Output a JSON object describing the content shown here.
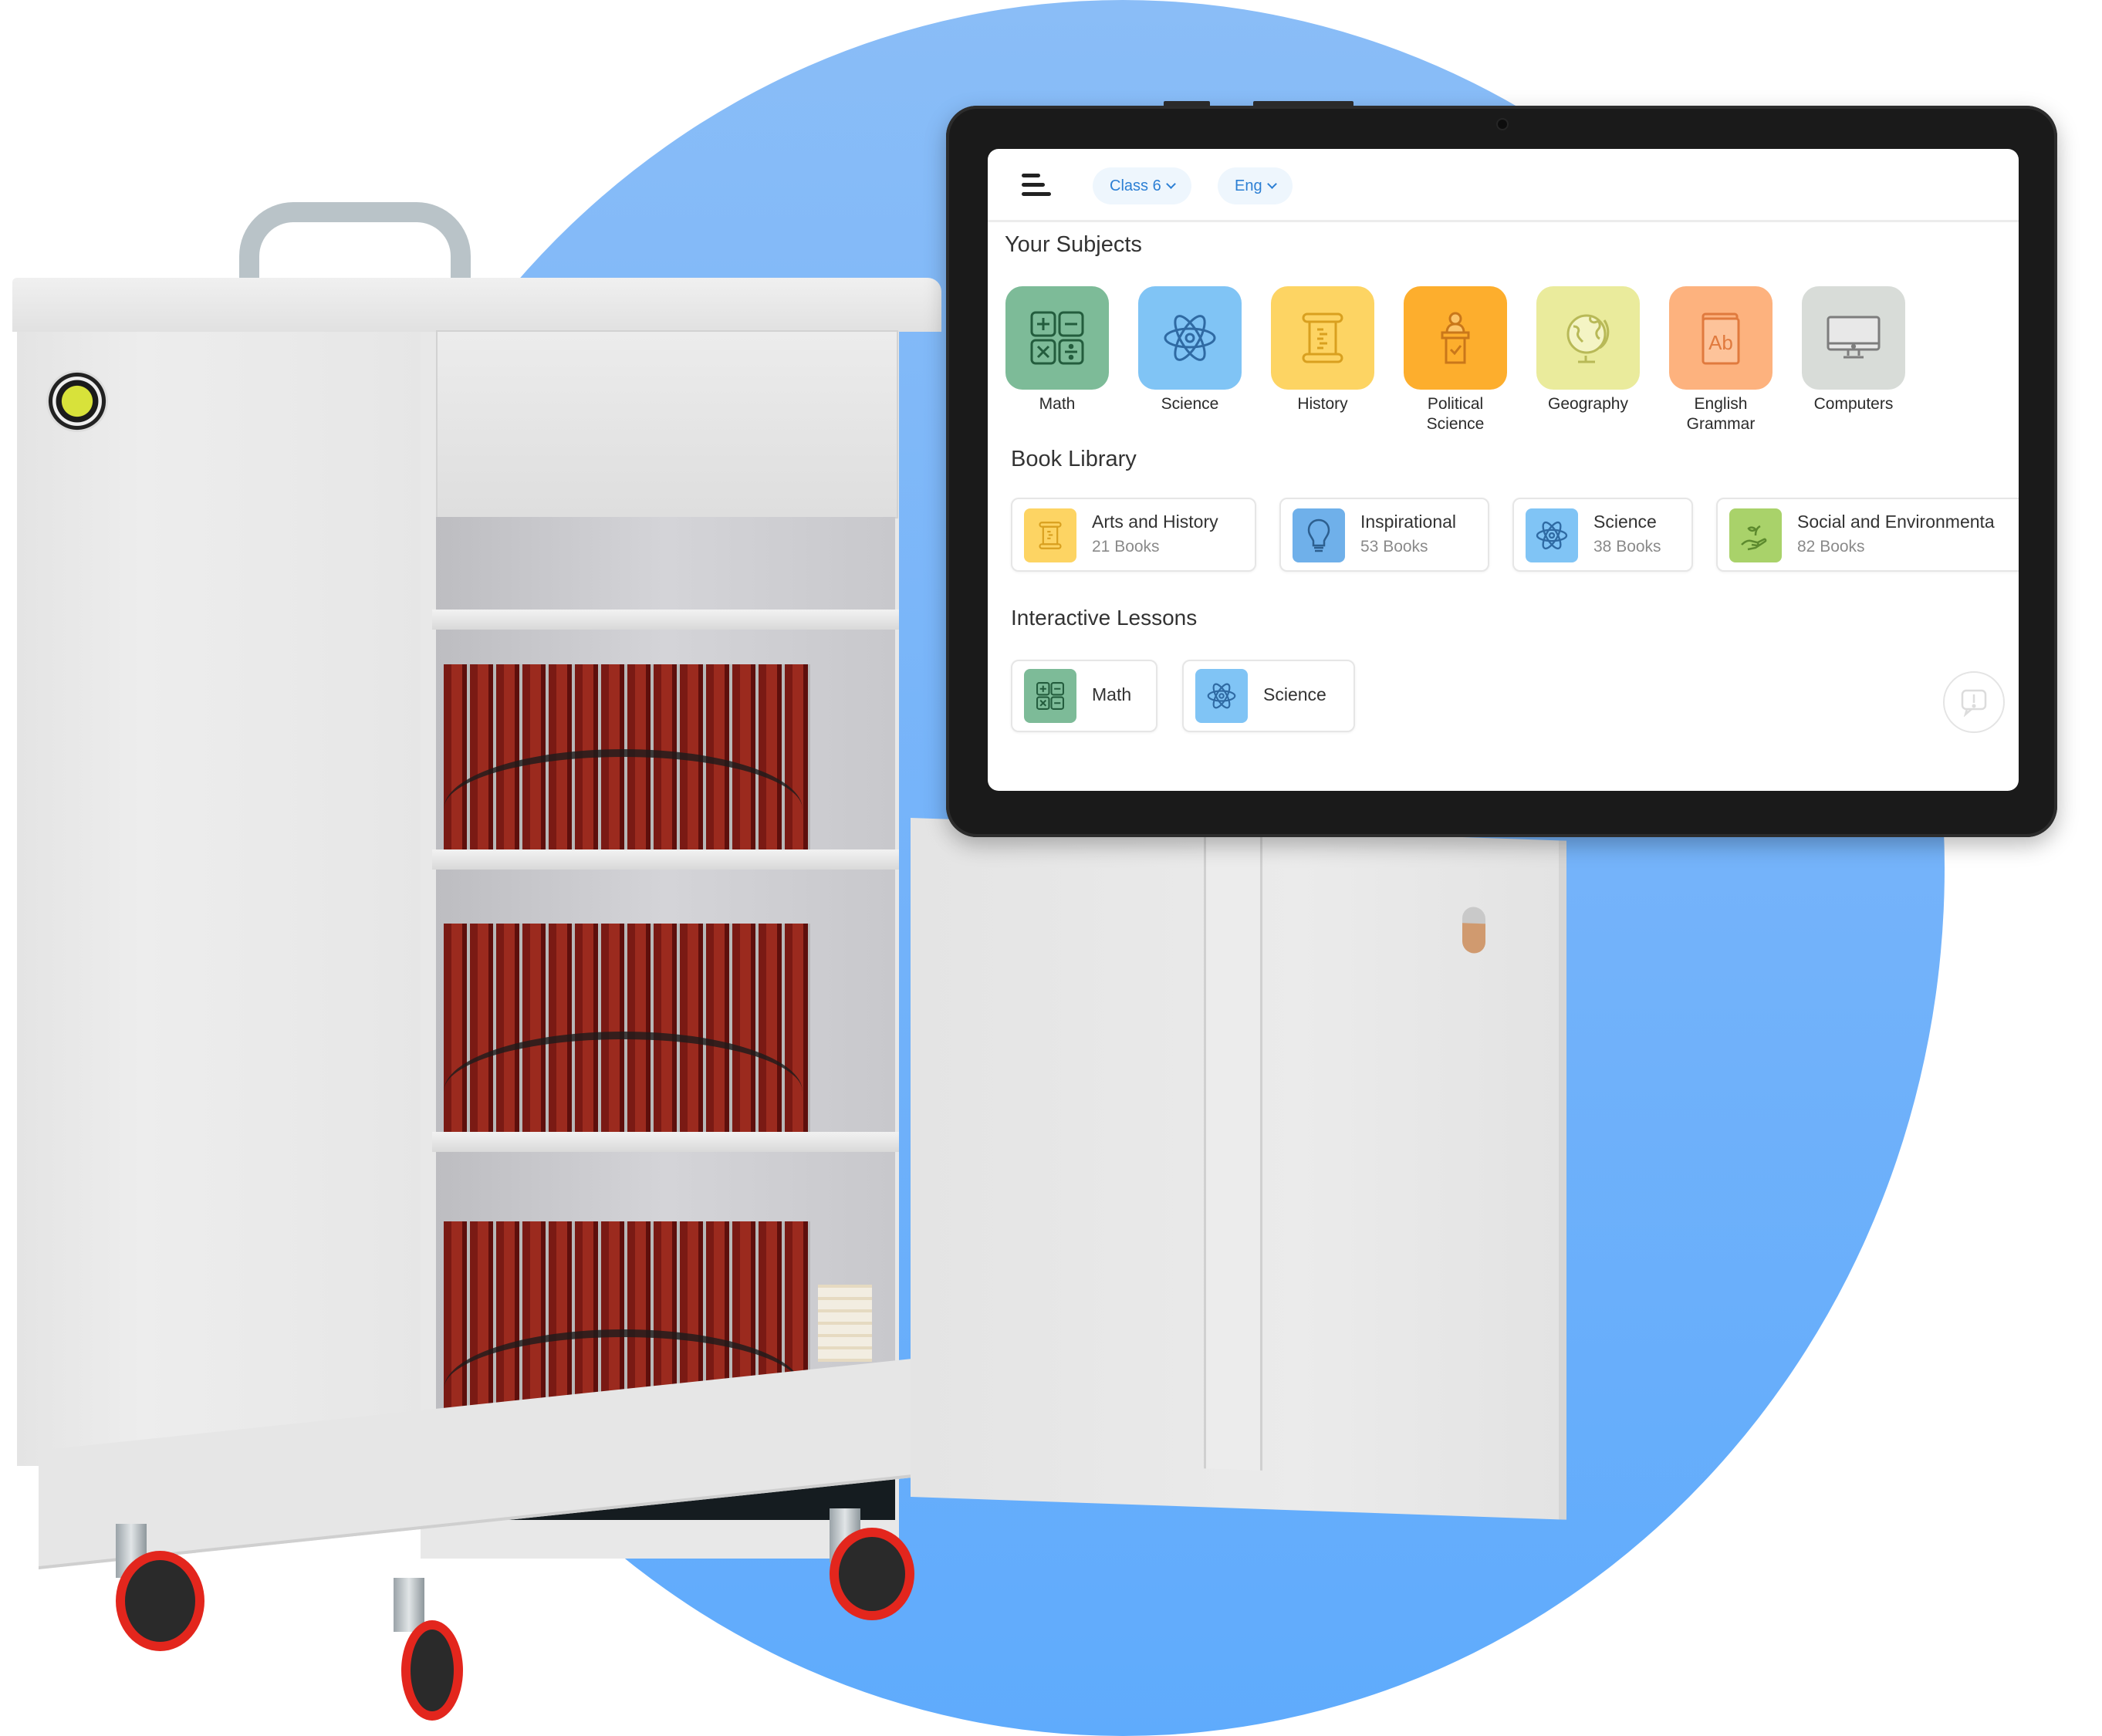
{
  "header": {
    "class_selector": "Class 6",
    "language_selector": "Eng"
  },
  "sections": {
    "subjects_title": "Your Subjects",
    "library_title": "Book Library",
    "lessons_title": "Interactive Lessons"
  },
  "subjects": [
    {
      "label": "Math",
      "icon": "calculator-icon",
      "color": "#7dbb98"
    },
    {
      "label": "Science",
      "icon": "atom-icon",
      "color": "#80c4f5"
    },
    {
      "label": "History",
      "icon": "scroll-icon",
      "color": "#fdd463"
    },
    {
      "label": "Political Science",
      "icon": "podium-icon",
      "color": "#fdae2d"
    },
    {
      "label": "Geography",
      "icon": "globe-icon",
      "color": "#eaeb9c"
    },
    {
      "label": "English Grammar",
      "icon": "book-ab-icon",
      "color": "#fdb27e"
    },
    {
      "label": "Computers",
      "icon": "monitor-icon",
      "color": "#d8dcd8"
    }
  ],
  "library": [
    {
      "title": "Arts and History",
      "count": "21 Books",
      "icon": "scroll-icon",
      "color": "#fdd463"
    },
    {
      "title": "Inspirational",
      "count": "53 Books",
      "icon": "lightbulb-icon",
      "color": "#6fb0ea"
    },
    {
      "title": "Science",
      "count": "38 Books",
      "icon": "atom-icon",
      "color": "#80c4f5"
    },
    {
      "title": "Social and Environmenta",
      "count": "82 Books",
      "icon": "plant-hand-icon",
      "color": "#a9d26a"
    }
  ],
  "lessons": [
    {
      "title": "Math",
      "icon": "calculator-icon",
      "color": "#7dbb98"
    },
    {
      "title": "Science",
      "icon": "atom-icon",
      "color": "#80c4f5"
    }
  ],
  "colors": {
    "accent": "#2c7fd4",
    "background_circle": "#72b2fa",
    "tablet_bezel": "#1a1a1a"
  }
}
